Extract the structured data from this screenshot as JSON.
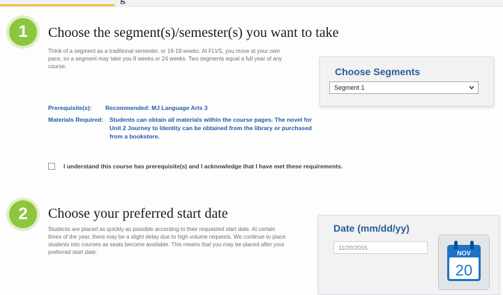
{
  "header": {
    "clipped_text": "g"
  },
  "section1": {
    "number": "1",
    "title": "Choose the segment(s)/semester(s) you want to take",
    "description": "Think of a segment as a traditional semester, or 16-18 weeks. At FLVS, you move at your own pace, so a segment may take you 8 weeks or 24 weeks. Two segments equal a full year of any course.",
    "prerequisite_label": "Prerequisite(s):",
    "prerequisite_value": "Recommended: MJ Language Arts 3",
    "materials_label": "Materials Required:",
    "materials_value": "Students can obtain all materials within the course pages. The novel for Unit 2 Journey to Identity can be obtained from the library or purchased from a bookstore.",
    "acknowledge_text": "I understand this course has prerequisite(s) and I acknowledge that I have met these requirements.",
    "acknowledge_checked": false
  },
  "segments_panel": {
    "title": "Choose Segments",
    "selected": "Segment 1"
  },
  "section2": {
    "number": "2",
    "title": "Choose your preferred start date",
    "description": "Students are placed as quickly as possible according to their requested start date. At certain times of the year, there may be a slight delay due to high volume requests. We continue to place students into courses as seats become available. This means that you may be placed after your preferred start date."
  },
  "date_panel": {
    "title": "Date (mm/dd/yy)",
    "value": "11/20/2015",
    "calendar_month": "NOV",
    "calendar_day": "20"
  },
  "colors": {
    "step_badge": "#8cc63f",
    "panel_title": "#2a5d95",
    "requirement_text": "#1f5ba8",
    "calendar_blue": "#1d74c6"
  },
  "icons": {
    "select_arrow": "chevron-down-icon",
    "calendar": "calendar-icon"
  }
}
